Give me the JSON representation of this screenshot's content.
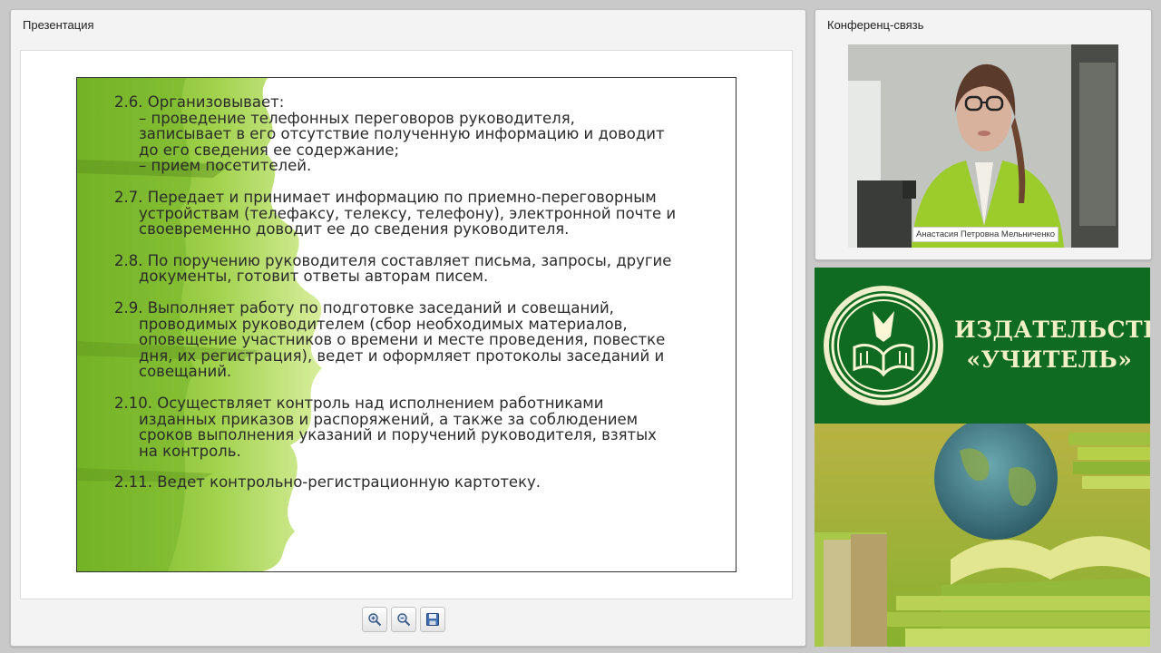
{
  "presentation": {
    "title": "Презентация",
    "items": [
      {
        "head": "2.6. Организовывает:",
        "lines": [
          "– проведение телефонных переговоров руководителя,",
          "записывает в его отсутствие полученную информацию и доводит",
          "до его сведения ее содержание;",
          "– прием посетителей."
        ]
      },
      {
        "head": "2.7. Передает и принимает информацию по приемно-переговорным",
        "lines": [
          "устройствам (телефаксу, телексу, телефону), электронной почте и",
          "своевременно доводит ее до сведения руководителя."
        ]
      },
      {
        "head": "2.8. По поручению руководителя составляет письма, запросы, другие",
        "lines": [
          "документы, готовит ответы авторам писем."
        ]
      },
      {
        "head": "2.9. Выполняет работу по подготовке заседаний и совещаний,",
        "lines": [
          "проводимых руководителем (сбор необходимых материалов,",
          "оповещение участников о времени и месте проведения, повестке",
          "дня, их регистрация), ведет и оформляет протоколы заседаний и",
          "совещаний."
        ]
      },
      {
        "head": "2.10. Осуществляет контроль над исполнением работниками",
        "lines": [
          "изданных приказов и распоряжений, а также за соблюдением",
          "сроков выполнения указаний и поручений руководителя, взятых",
          "на контроль."
        ]
      },
      {
        "head": "2.11. Ведет контрольно-регистрационную картотеку.",
        "lines": []
      }
    ],
    "toolbar": {
      "zoom_in_icon": "zoom-in-icon",
      "zoom_out_icon": "zoom-out-icon",
      "save_icon": "floppy-disk-icon"
    }
  },
  "conference": {
    "title": "Конференц-связь",
    "participant_name": "Анастасия Петровна Мельниченко"
  },
  "banner": {
    "line1": "ИЗДАТЕЛЬСТВО",
    "line2": "«УЧИТЕЛЬ»"
  },
  "colors": {
    "accent_green": "#0f6b22",
    "splash_green": "#8cc63f",
    "brand_text": "#f3f0c8"
  }
}
